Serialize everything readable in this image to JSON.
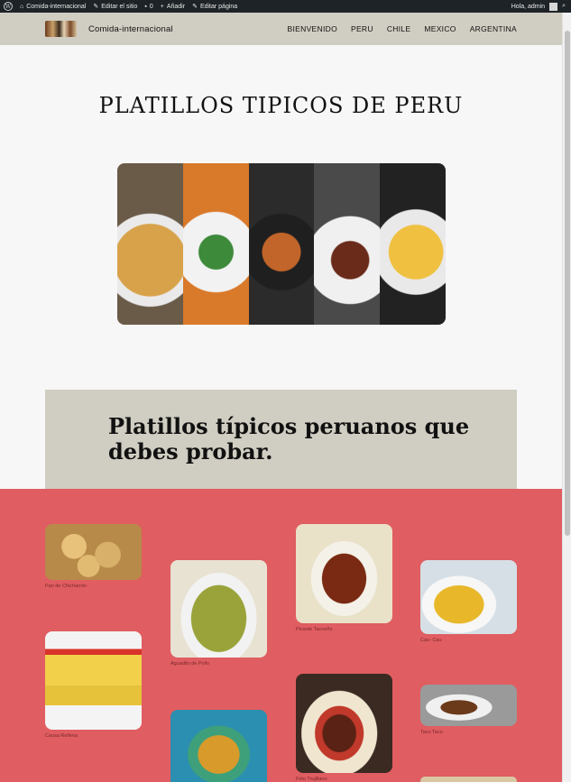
{
  "adminbar": {
    "site": "Comida-internacional",
    "edit_site": "Editar el sitio",
    "comments_count": "0",
    "add": "Añadir",
    "edit_page": "Editar página",
    "greeting": "Hola, admin"
  },
  "header": {
    "site_title": "Comida-internacional",
    "nav": [
      "BIENVENIDO",
      "PERU",
      "CHILE",
      "MEXICO",
      "ARGENTINA"
    ]
  },
  "hero": {
    "title": "PLATILLOS TIPICOS DE PERU"
  },
  "section": {
    "heading": "Platillos típicos peruanos que debes probar."
  },
  "dishes": [
    {
      "name": "Pan de Chicharrón"
    },
    {
      "name": "Aguadito de Pollo"
    },
    {
      "name": "Picante Tacneño"
    },
    {
      "name": "Cau- Cau"
    },
    {
      "name": "Causa Rellena"
    },
    {
      "name": "Frito Trujillano"
    },
    {
      "name": "Tacu Tacu"
    }
  ],
  "colors": {
    "adminbar": "#1d2327",
    "header": "#d0cdc2",
    "beige": "#d0cdc2",
    "red_section": "#e05d61"
  }
}
